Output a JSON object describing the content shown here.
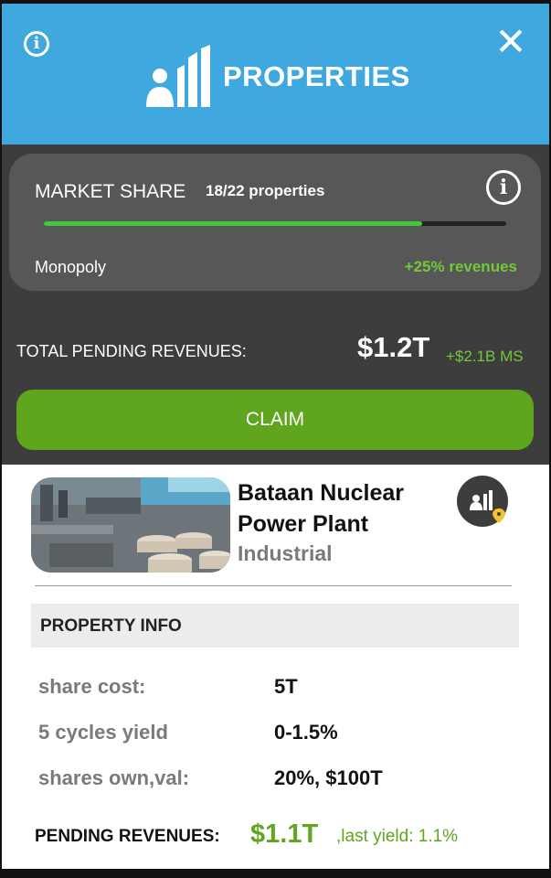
{
  "header": {
    "title": "PROPERTIES",
    "info_icon": "info-icon",
    "close_icon": "close-icon",
    "title_icon": "properties-icon",
    "color": "#3fa9df"
  },
  "market_share": {
    "label": "MARKET SHARE",
    "count": "18/22 properties",
    "progress": 0.818,
    "tier": "Monopoly",
    "bonus": "+25% revenues"
  },
  "totals": {
    "label": "TOTAL PENDING REVENUES:",
    "value": "$1.2T",
    "ms_bonus": "+$2.1B MS"
  },
  "claim_button": "CLAIM",
  "property": {
    "name_line1": "Bataan Nuclear",
    "name_line2": "Power Plant",
    "type": "Industrial",
    "badge_icon": "property-owner-location-icon"
  },
  "property_info": {
    "heading": "PROPERTY INFO",
    "rows": [
      {
        "label": "share cost:",
        "value": "5T"
      },
      {
        "label": "5 cycles yield",
        "value": "0-1.5%"
      },
      {
        "label": "shares own,val:",
        "value": "20%, $100T"
      }
    ]
  },
  "pending": {
    "label": "PENDING REVENUES:",
    "value": "$1.1T",
    "last_yield": ",last yield: 1.1%"
  },
  "colors": {
    "accent_green": "#5fa51d",
    "progress_green": "#3fc93b",
    "dark_panel": "#3d3d3d"
  }
}
